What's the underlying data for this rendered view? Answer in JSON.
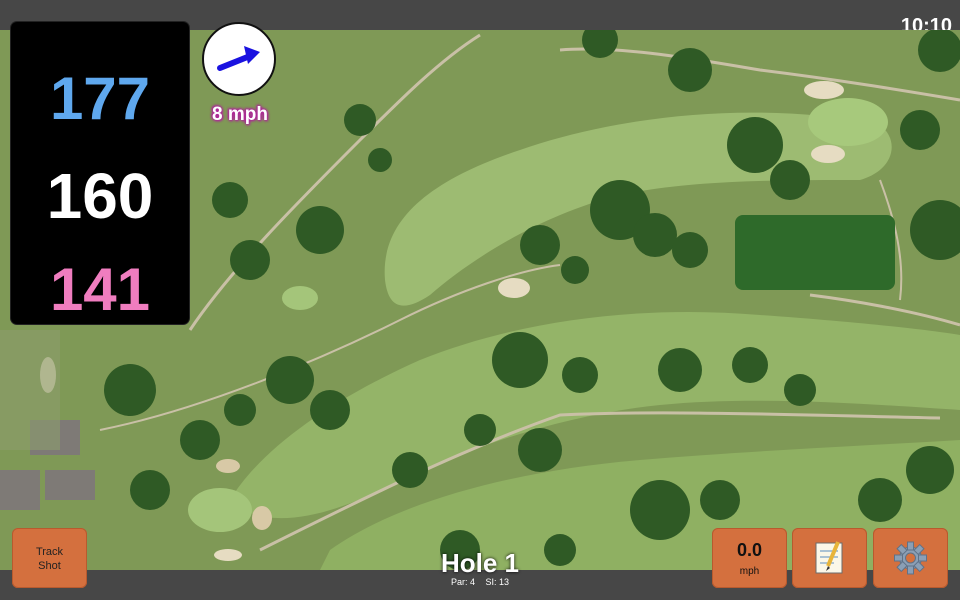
{
  "status_bar": {
    "time": "10:10"
  },
  "distances": {
    "back": "177",
    "middle": "160",
    "front": "141"
  },
  "wind": {
    "speed": "8 mph",
    "direction_icon": "arrow-right-up-icon",
    "arrow_color": "#1a12e0"
  },
  "track_shot": {
    "line1": "Track",
    "line2": "Shot"
  },
  "speed_button": {
    "value": "0.0",
    "unit": "mph"
  },
  "notes_button": {
    "icon": "notepad-icon"
  },
  "settings_button": {
    "icon": "gear-icon"
  },
  "hole": {
    "title": "Hole 1",
    "par": "Par: 4",
    "si": "SI: 13"
  },
  "colors": {
    "back_distance": "#5fa8ee",
    "middle_distance": "#ffffff",
    "front_distance": "#f07dbf",
    "button": "#d4703e",
    "bar": "#474747"
  }
}
